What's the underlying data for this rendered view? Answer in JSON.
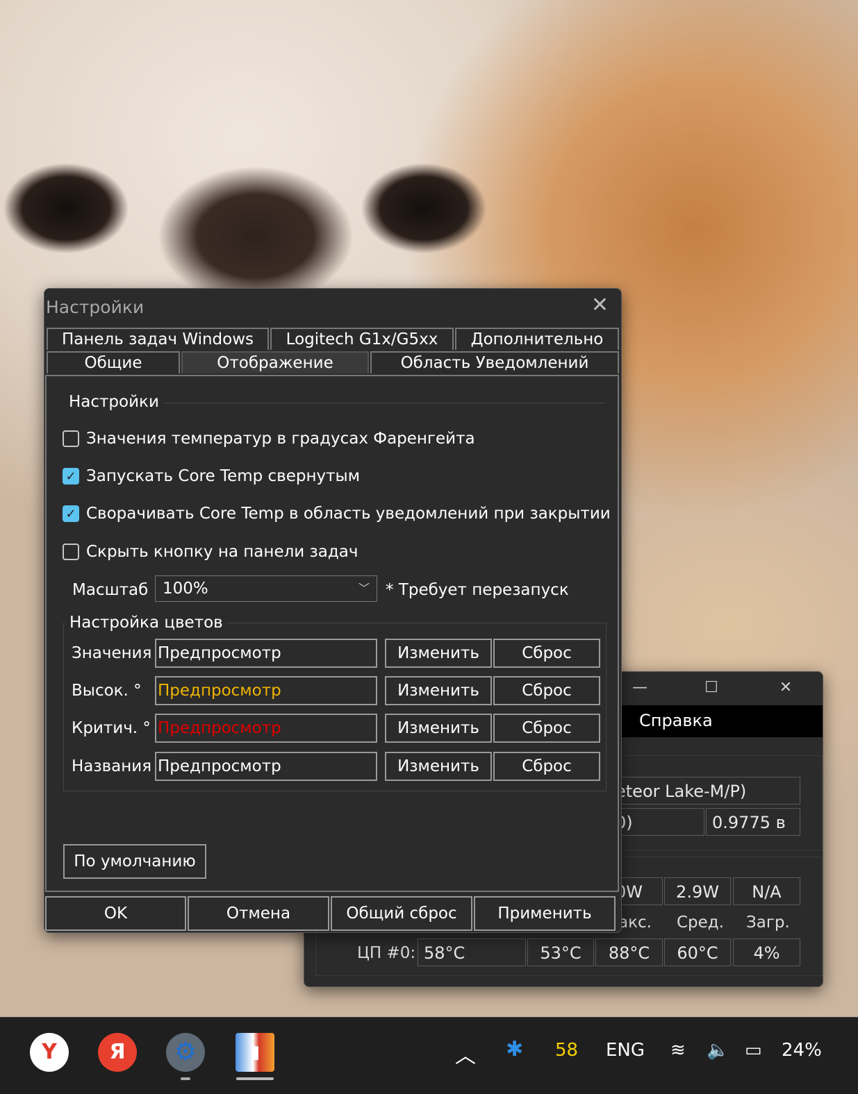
{
  "main_window": {
    "menu_help": "Справка",
    "cpu_model_fragment": "eteor Lake-M/P)",
    "freq_fragment": "0)",
    "voltage": "0.9775 в",
    "power_values": [
      "0W",
      "2.9W",
      "N/A"
    ],
    "column_headers": [
      "акс.",
      "Сред.",
      "Загр."
    ],
    "core_row": {
      "label": "ЦП #0:",
      "current": "58°C",
      "min": "53°C",
      "max": "88°C",
      "avg": "60°C",
      "load": "4%"
    }
  },
  "settings": {
    "title": "Настройки",
    "tabs_row1": [
      "Панель задач Windows",
      "Logitech G1x/G5xx",
      "Дополнительно"
    ],
    "tabs_row2": [
      "Общие",
      "Отображение",
      "Область Уведомлений"
    ],
    "active_tab": "Отображение",
    "group_settings_title": "Настройки",
    "checkboxes": [
      {
        "label": "Значения температур в градусах Фаренгейта",
        "checked": false
      },
      {
        "label": "Запускать Core Temp свернутым",
        "checked": true
      },
      {
        "label": "Сворачивать Core Temp в область уведомлений при закрытии",
        "checked": true
      },
      {
        "label": "Скрыть кнопку на панели задач",
        "checked": false
      }
    ],
    "scale_label": "Масштаб",
    "scale_value": "100%",
    "restart_note": "* Требует перезапуск",
    "colors_group_title": "Настройка цветов",
    "color_rows": [
      {
        "label": "Значения",
        "preview": "Предпросмотр",
        "color": "#ffffff"
      },
      {
        "label": "Высок. °",
        "preview": "Предпросмотр",
        "color": "#f0b400"
      },
      {
        "label": "Критич. °",
        "preview": "Предпросмотр",
        "color": "#e00000"
      },
      {
        "label": "Названия",
        "preview": "Предпросмотр",
        "color": "#ffffff"
      }
    ],
    "change_label": "Изменить",
    "reset_label": "Сброс",
    "defaults_button": "По умолчанию",
    "footer_buttons": [
      "OK",
      "Отмена",
      "Общий сброс",
      "Применить"
    ]
  },
  "taskbar": {
    "apps": [
      "yandex-browser-icon",
      "yandex-icon",
      "settings-gear-icon",
      "core-temp-icon"
    ],
    "tray_temp": "58",
    "tray_temp_color": "#f5d000",
    "language": "ENG",
    "battery": "24%"
  }
}
